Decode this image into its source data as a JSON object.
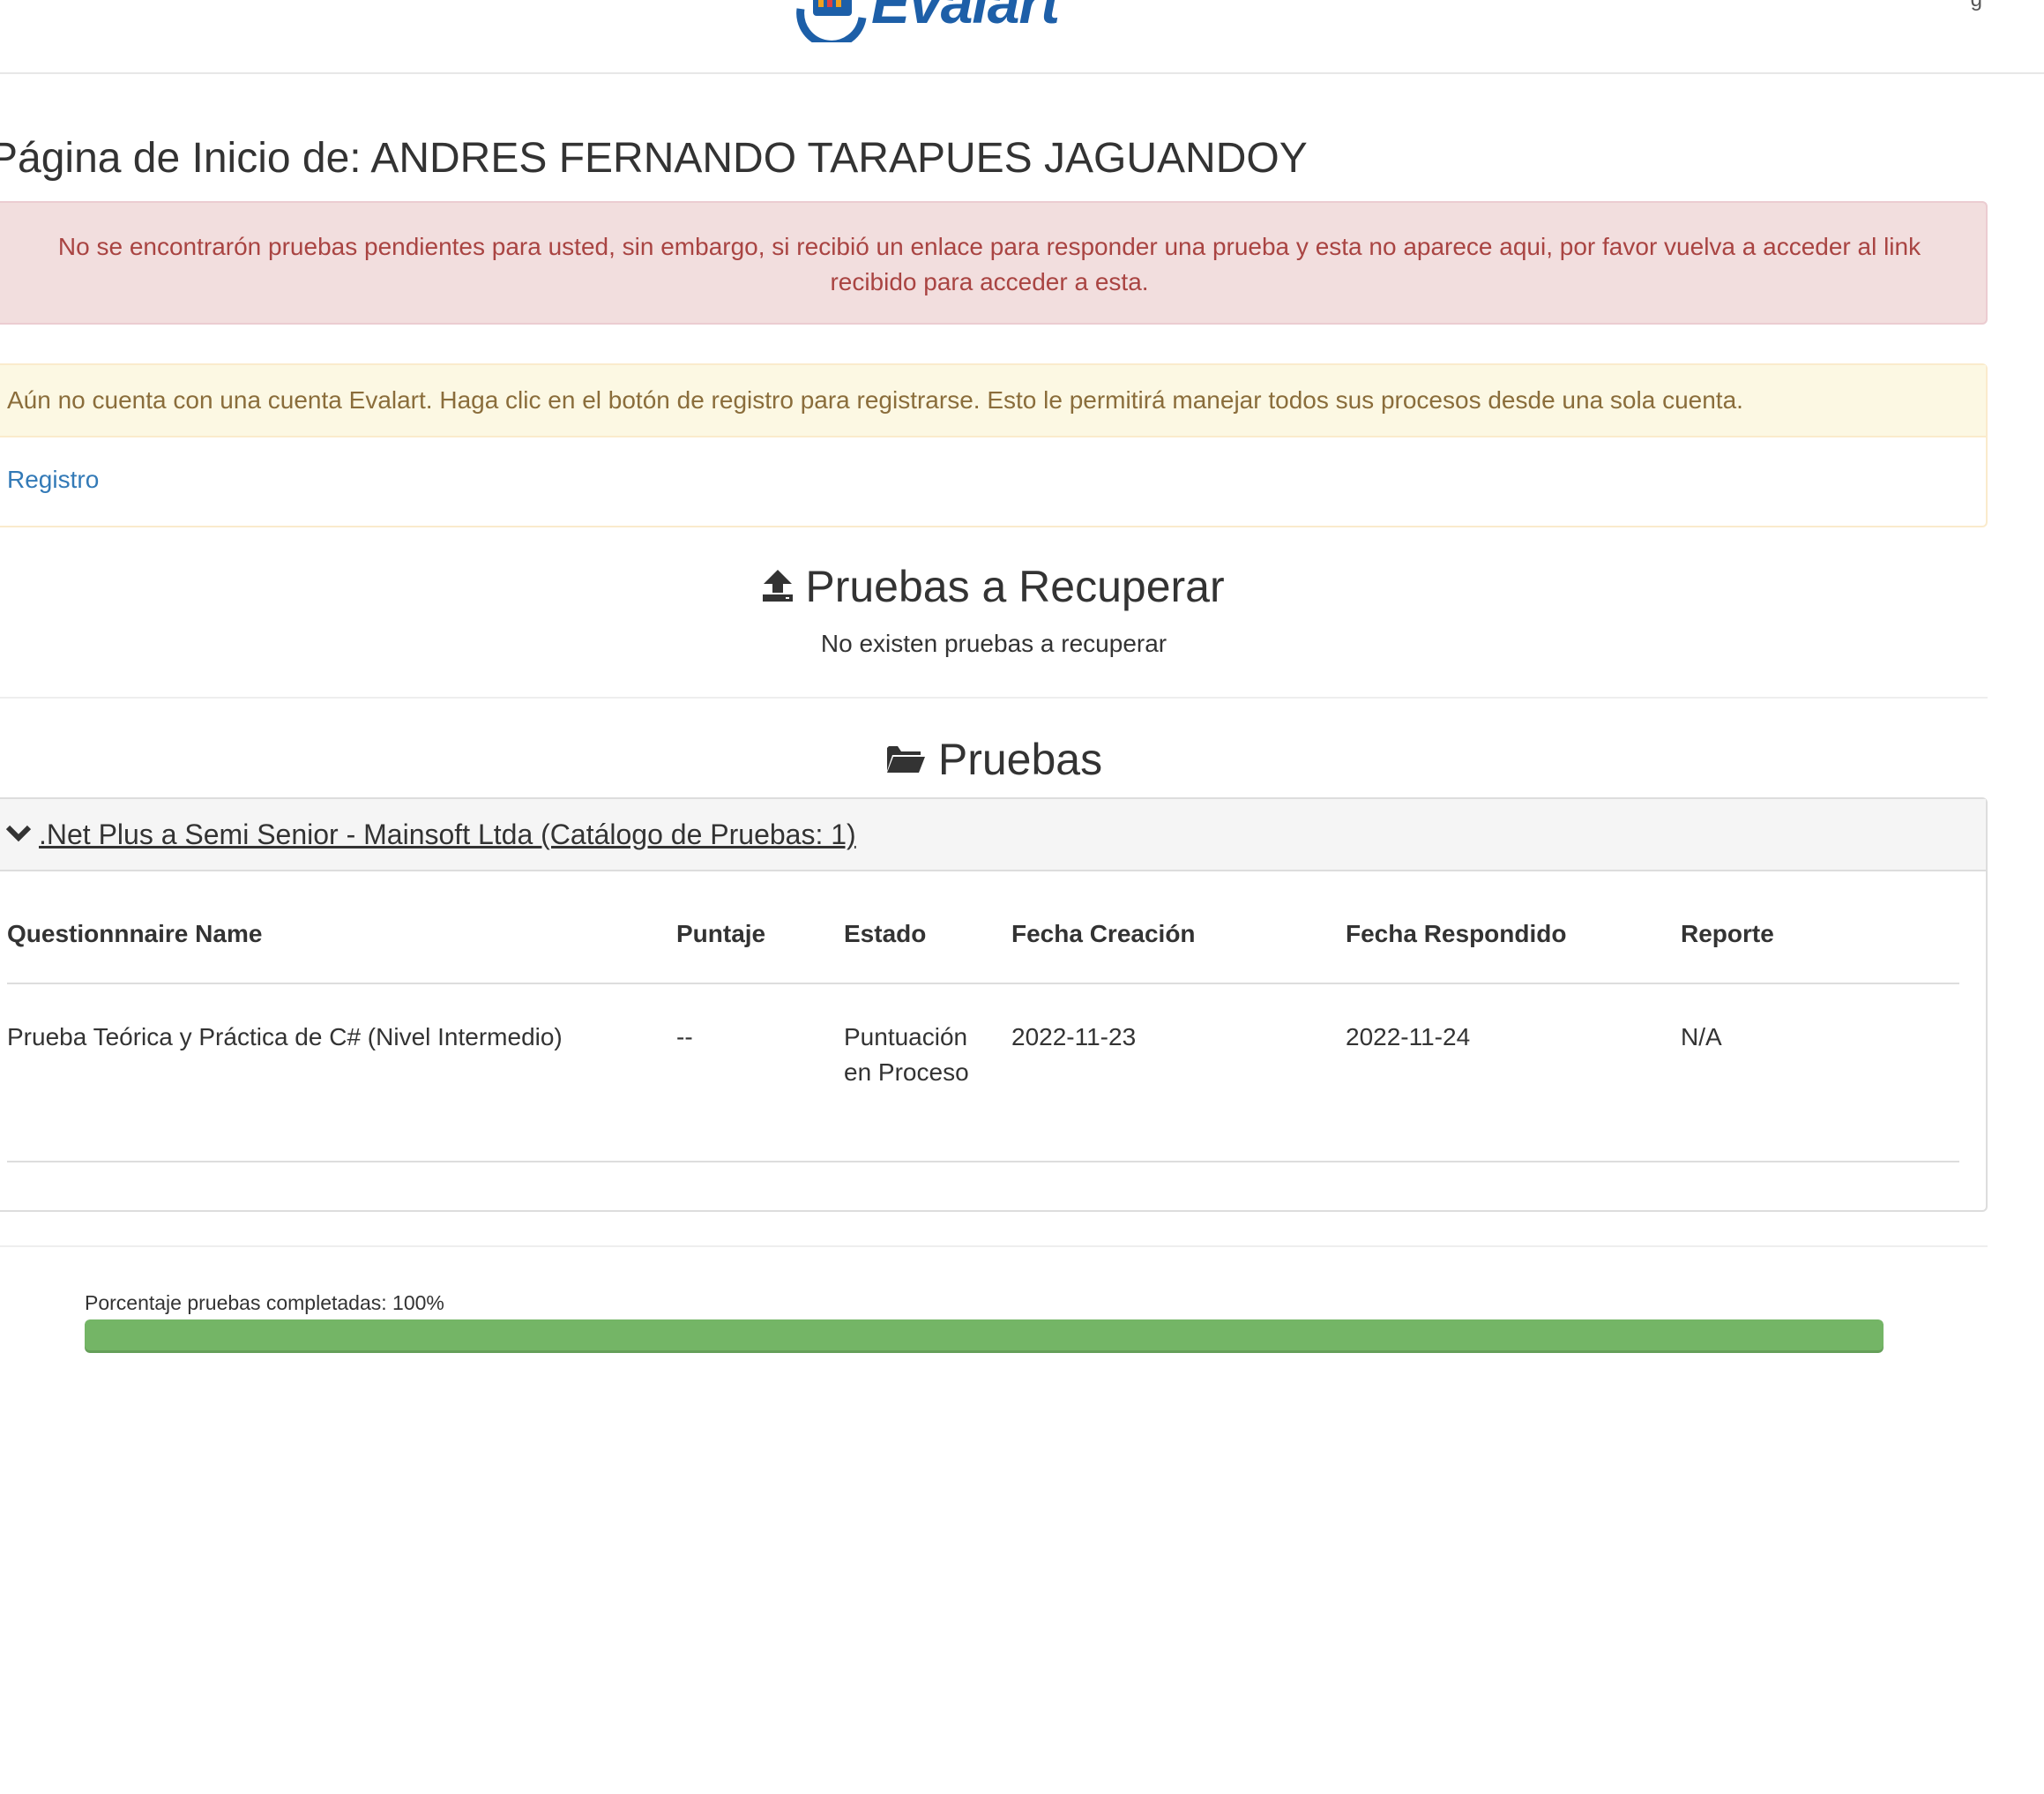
{
  "header": {
    "logo_text": "Evalart",
    "corner_mark": "g"
  },
  "page": {
    "title": "Página de Inicio de: ANDRES FERNANDO TARAPUES JAGUANDOY"
  },
  "alerts": {
    "danger_text": "No se encontrarón pruebas pendientes para usted, sin embargo, si recibió un enlace para responder una prueba y esta no aparece aqui, por favor vuelva a acceder al link recibido para acceder a esta.",
    "warning_text": "Aún no cuenta con una cuenta Evalart. Haga clic en el botón de registro para registrarse. Esto le permitirá manejar todos sus procesos desde una sola cuenta.",
    "register_link": "Registro"
  },
  "recover": {
    "title": "Pruebas a Recuperar",
    "icon": "upload-icon",
    "empty_text": "No existen pruebas a recuperar"
  },
  "tests": {
    "title": "Pruebas",
    "icon": "folder-open-icon",
    "group": {
      "title": ".Net Plus a Semi Senior - Mainsoft Ltda (Catálogo de Pruebas: 1)",
      "icon": "chevron-down-icon"
    },
    "columns": [
      "Questionnnaire Name",
      "Puntaje",
      "Estado",
      "Fecha Creación",
      "Fecha Respondido",
      "Reporte"
    ],
    "rows": [
      {
        "name": "Prueba Teórica y Práctica de C# (Nivel Intermedio)",
        "score": "--",
        "status": "Puntuación en Proceso",
        "created": "2022-11-23",
        "answered": "2022-11-24",
        "report": "N/A"
      }
    ]
  },
  "progress": {
    "label": "Porcentaje pruebas completadas: 100%",
    "percent": 100,
    "color": "#74b566"
  }
}
